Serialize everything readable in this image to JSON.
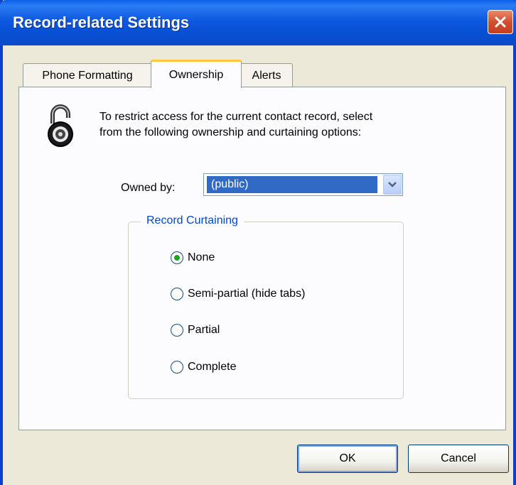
{
  "window": {
    "title": "Record-related Settings"
  },
  "tabs": [
    {
      "label": "Phone Formatting",
      "active": false
    },
    {
      "label": "Ownership",
      "active": true
    },
    {
      "label": "Alerts",
      "active": false
    }
  ],
  "ownership": {
    "description_line1": "To restrict access for the current contact record, select",
    "description_line2": "from the following ownership and curtaining options:",
    "icon": "padlock-icon",
    "owned_by_label": "Owned by:",
    "owned_by_value": "(public)"
  },
  "curtaining": {
    "legend": "Record Curtaining",
    "options": [
      {
        "label": "None",
        "selected": true
      },
      {
        "label": "Semi-partial (hide tabs)",
        "selected": false
      },
      {
        "label": "Partial",
        "selected": false
      },
      {
        "label": "Complete",
        "selected": false
      }
    ]
  },
  "buttons": {
    "ok_label": "OK",
    "cancel_label": "Cancel"
  },
  "colors": {
    "titlebar": "#0a55e0",
    "selection": "#316ac5",
    "group_legend": "#0046d5",
    "radio_checked": "#21a121"
  }
}
